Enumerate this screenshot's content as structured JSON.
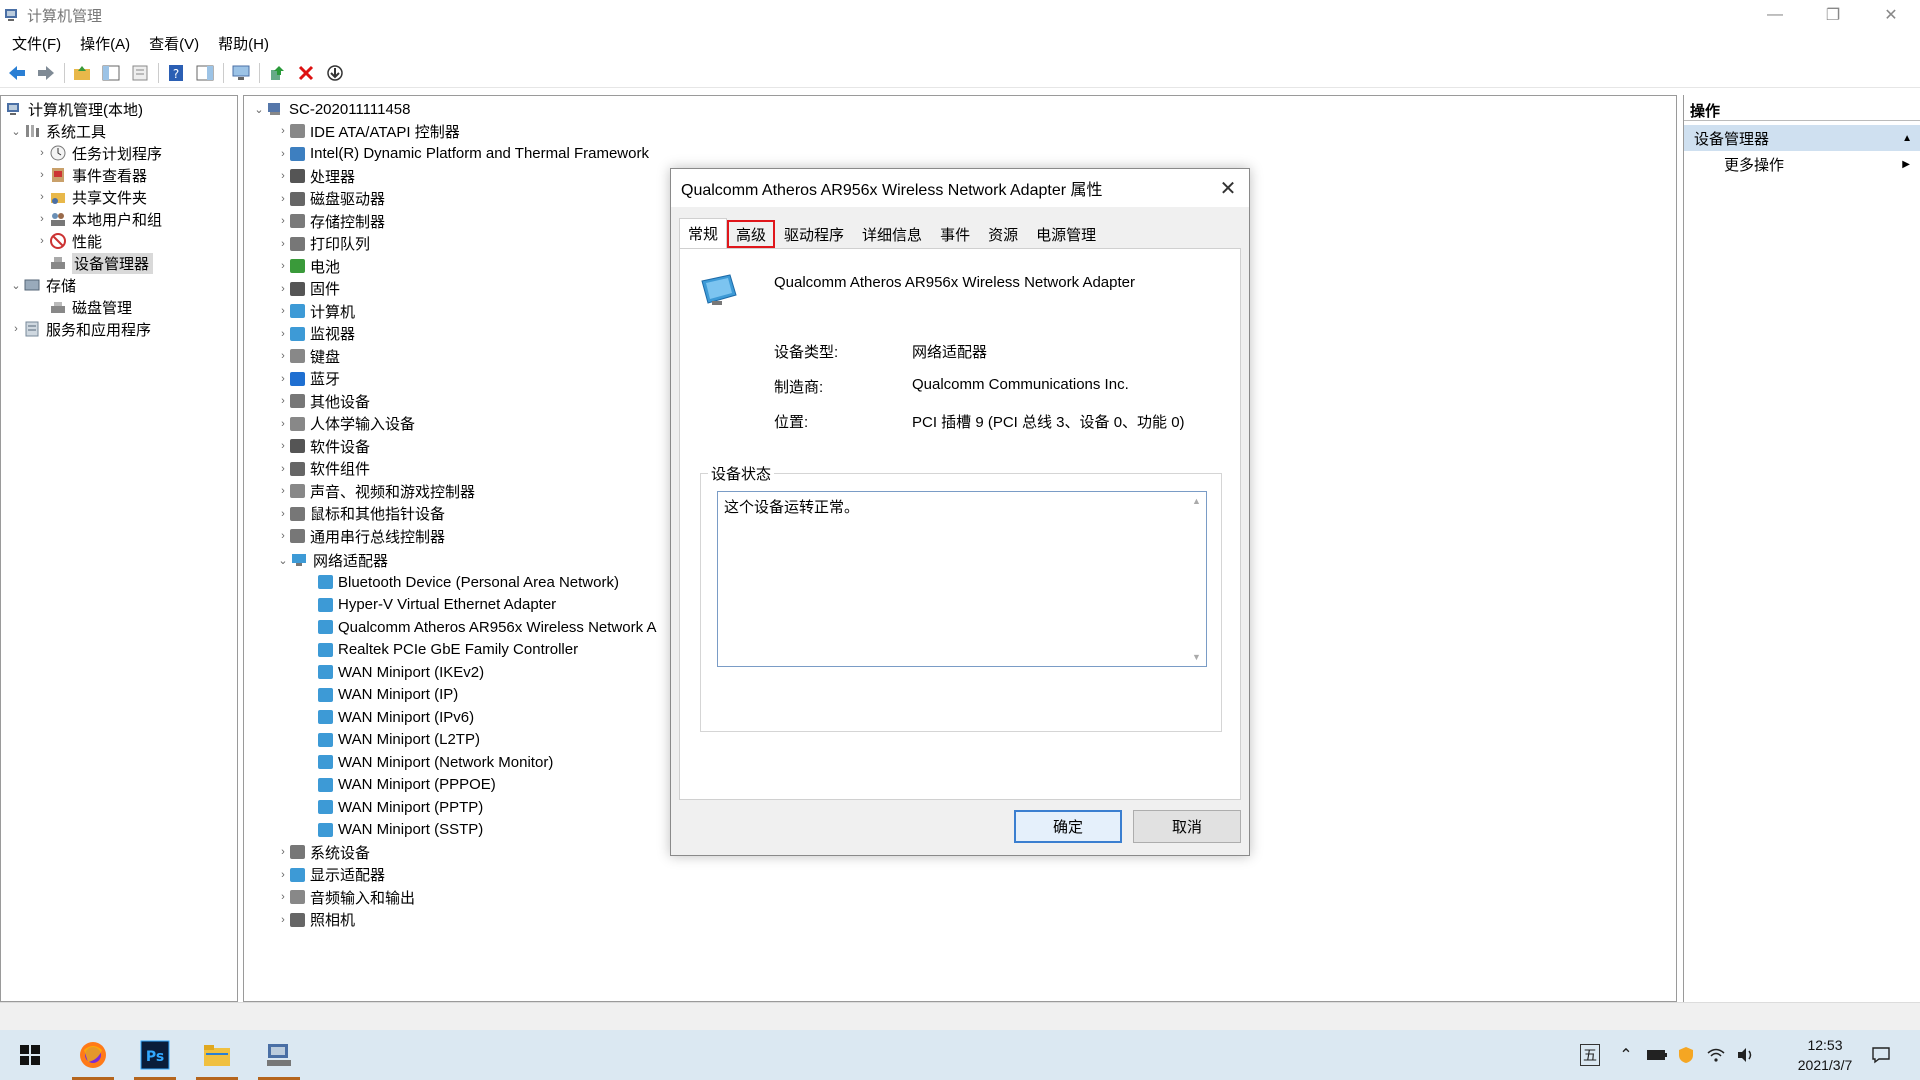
{
  "window": {
    "title": "计算机管理",
    "minimize": "—",
    "restore": "❐",
    "close": "✕"
  },
  "menu": [
    "文件(F)",
    "操作(A)",
    "查看(V)",
    "帮助(H)"
  ],
  "left_tree": {
    "root": "计算机管理(本地)",
    "system_tools": "系统工具",
    "items": [
      "任务计划程序",
      "事件查看器",
      "共享文件夹",
      "本地用户和组",
      "性能",
      "设备管理器"
    ],
    "storage": "存储",
    "disk_mgmt": "磁盘管理",
    "services": "服务和应用程序"
  },
  "device_tree": {
    "computer": "SC-202011111458",
    "categories_top": [
      "IDE ATA/ATAPI 控制器",
      "Intel(R) Dynamic Platform and Thermal Framework",
      "处理器",
      "磁盘驱动器",
      "存储控制器",
      "打印队列",
      "电池",
      "固件",
      "计算机",
      "监视器",
      "键盘",
      "蓝牙",
      "其他设备",
      "人体学输入设备",
      "软件设备",
      "软件组件",
      "声音、视频和游戏控制器",
      "鼠标和其他指针设备",
      "通用串行总线控制器"
    ],
    "network": "网络适配器",
    "network_children": [
      "Bluetooth Device (Personal Area Network)",
      "Hyper-V Virtual Ethernet Adapter",
      "Qualcomm Atheros AR956x Wireless Network A",
      "Realtek PCIe GbE Family Controller",
      "WAN Miniport (IKEv2)",
      "WAN Miniport (IP)",
      "WAN Miniport (IPv6)",
      "WAN Miniport (L2TP)",
      "WAN Miniport (Network Monitor)",
      "WAN Miniport (PPPOE)",
      "WAN Miniport (PPTP)",
      "WAN Miniport (SSTP)"
    ],
    "categories_bottom": [
      "系统设备",
      "显示适配器",
      "音频输入和输出",
      "照相机"
    ]
  },
  "actions": {
    "header": "操作",
    "section": "设备管理器",
    "more": "更多操作"
  },
  "dialog": {
    "title": "Qualcomm Atheros AR956x Wireless Network Adapter 属性",
    "tabs": [
      "常规",
      "高级",
      "驱动程序",
      "详细信息",
      "事件",
      "资源",
      "电源管理"
    ],
    "device_name": "Qualcomm Atheros AR956x Wireless Network Adapter",
    "type_label": "设备类型:",
    "type_value": "网络适配器",
    "mfr_label": "制造商:",
    "mfr_value": "Qualcomm Communications Inc.",
    "loc_label": "位置:",
    "loc_value": "PCI 插槽 9 (PCI 总线 3、设备 0、功能 0)",
    "status_group": "设备状态",
    "status_text": "这个设备运转正常。",
    "ok": "确定",
    "cancel": "取消"
  },
  "taskbar": {
    "ime": "五",
    "time": "12:53",
    "date": "2021/3/7"
  }
}
